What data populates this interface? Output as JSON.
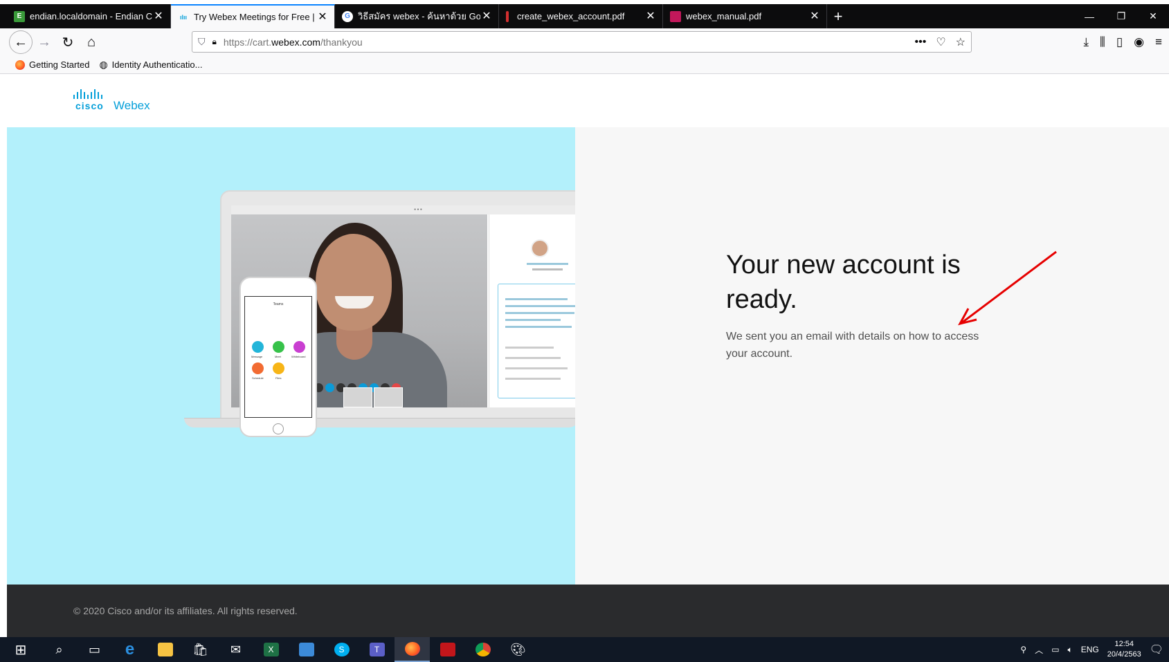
{
  "browser": {
    "tabs": [
      {
        "title": "endian.localdomain - Endian C",
        "active": false,
        "favicon": "endian-icon"
      },
      {
        "title": "Try Webex Meetings for Free | =",
        "active": true,
        "favicon": "cisco-icon"
      },
      {
        "title": "วิธีสมัคร webex - ค้นหาด้วย Goog",
        "active": false,
        "favicon": "google-icon"
      },
      {
        "title": "create_webex_account.pdf",
        "active": false,
        "favicon": "pdf-icon"
      },
      {
        "title": "webex_manual.pdf",
        "active": false,
        "favicon": "pdf-icon"
      }
    ],
    "url_prefix": "https://cart.",
    "url_domain": "webex.com",
    "url_path": "/thankyou",
    "bookmarks": [
      {
        "label": "Getting Started",
        "icon": "firefox-icon"
      },
      {
        "label": "Identity Authenticatio...",
        "icon": "globe-icon"
      }
    ]
  },
  "page": {
    "logo_cisco": "cisco",
    "logo_webex": "Webex",
    "headline": "Your new account is ready.",
    "subtext": "We sent you an email with details on how to access your account.",
    "footer": "© 2020 Cisco and/or its affiliates. All rights reserved.",
    "illustration": {
      "phone_title": "Teams",
      "phone_buttons": [
        "Message",
        "Meet",
        "Whiteboard",
        "Schedule",
        "Files"
      ]
    }
  },
  "taskbar": {
    "language": "ENG",
    "time": "12:54",
    "date": "20/4/2563"
  },
  "colors": {
    "hero_left_bg": "#b3f0fb",
    "hero_right_bg": "#f7f7f7",
    "footer_bg": "#2a2b2d",
    "brand": "#049fd9",
    "annotation_arrow": "#e60000"
  }
}
